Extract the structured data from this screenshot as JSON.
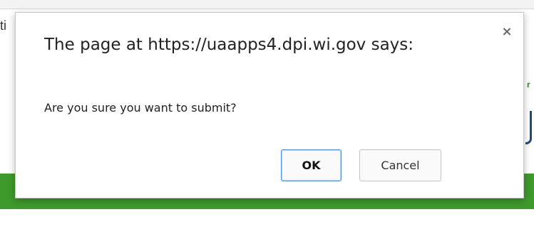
{
  "background": {
    "cut_text": "ti",
    "accent_green": "#3e9a2a"
  },
  "dialog": {
    "title": "The page at https://uaapps4.dpi.wi.gov says:",
    "message": "Are you sure you want to submit?",
    "close_glyph": "×",
    "ok_label": "OK",
    "cancel_label": "Cancel",
    "focus_color": "#4d90fe"
  }
}
